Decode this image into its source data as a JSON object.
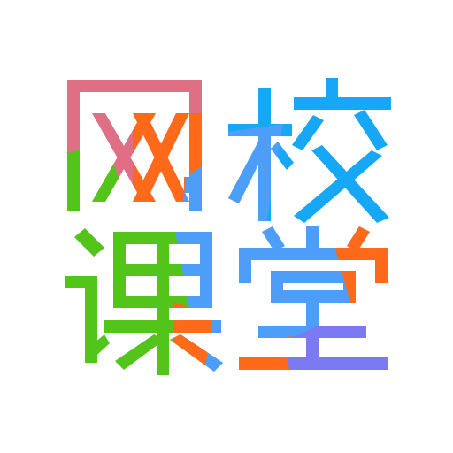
{
  "logo": {
    "characters": [
      "网",
      "校",
      "课",
      "堂"
    ],
    "colors": {
      "pink": "#DF6F84",
      "green": "#52C41A",
      "orange": "#FF6A1A",
      "blue": "#4D9EF8",
      "sky": "#16A8F6",
      "purple": "#7C7AF2"
    }
  }
}
